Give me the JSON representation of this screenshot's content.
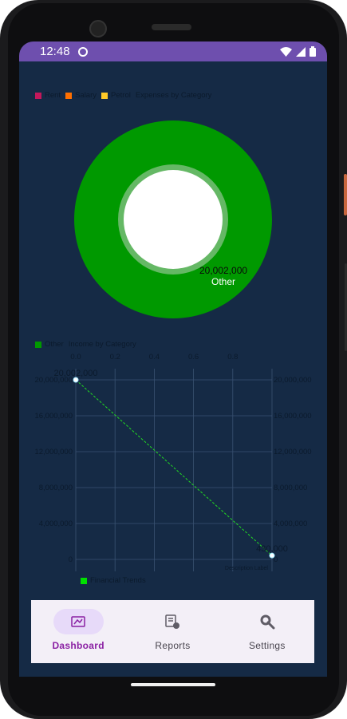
{
  "status_bar": {
    "time": "12:48"
  },
  "pie_chart": {
    "legend": [
      {
        "label": "Rent",
        "color": "#c2185b"
      },
      {
        "label": "Salary",
        "color": "#ff6f00"
      },
      {
        "label": "Petrol",
        "color": "#ffca28"
      }
    ],
    "description": "Expenses by Category"
  },
  "line_chart": {
    "legend": [
      {
        "label": "Other",
        "color": "#009900"
      }
    ],
    "description": "Income by Category",
    "corner_label": "Description Label",
    "bottom_legend": {
      "label": "Financial Trends",
      "color": "#00e000"
    }
  },
  "chart_data": [
    {
      "type": "pie",
      "title": "Expenses by Category",
      "slices": [
        {
          "name": "Other",
          "value": 20002000,
          "value_label": "20,002,000",
          "color": "#009900"
        }
      ]
    },
    {
      "type": "line",
      "title": "Income by Category",
      "x_top_ticks": [
        "0.0",
        "0.2",
        "0.4",
        "0.6",
        "0.8"
      ],
      "y_ticks": [
        "20,000,000",
        "16,000,000",
        "12,000,000",
        "8,000,000",
        "4,000,000",
        "0"
      ],
      "xlim": [
        0,
        1
      ],
      "ylim": [
        0,
        20000000
      ],
      "series": [
        {
          "name": "Financial Trends",
          "x": [
            0,
            1
          ],
          "y": [
            20002000,
            430000
          ],
          "value_labels": [
            "20,002,000",
            "430,000"
          ],
          "color": "#22dd22"
        }
      ]
    }
  ],
  "bottom_nav": {
    "items": [
      {
        "label": "Dashboard",
        "icon": "dashboard-icon",
        "active": true
      },
      {
        "label": "Reports",
        "icon": "reports-icon",
        "active": false
      },
      {
        "label": "Settings",
        "icon": "settings-icon",
        "active": false
      }
    ]
  }
}
